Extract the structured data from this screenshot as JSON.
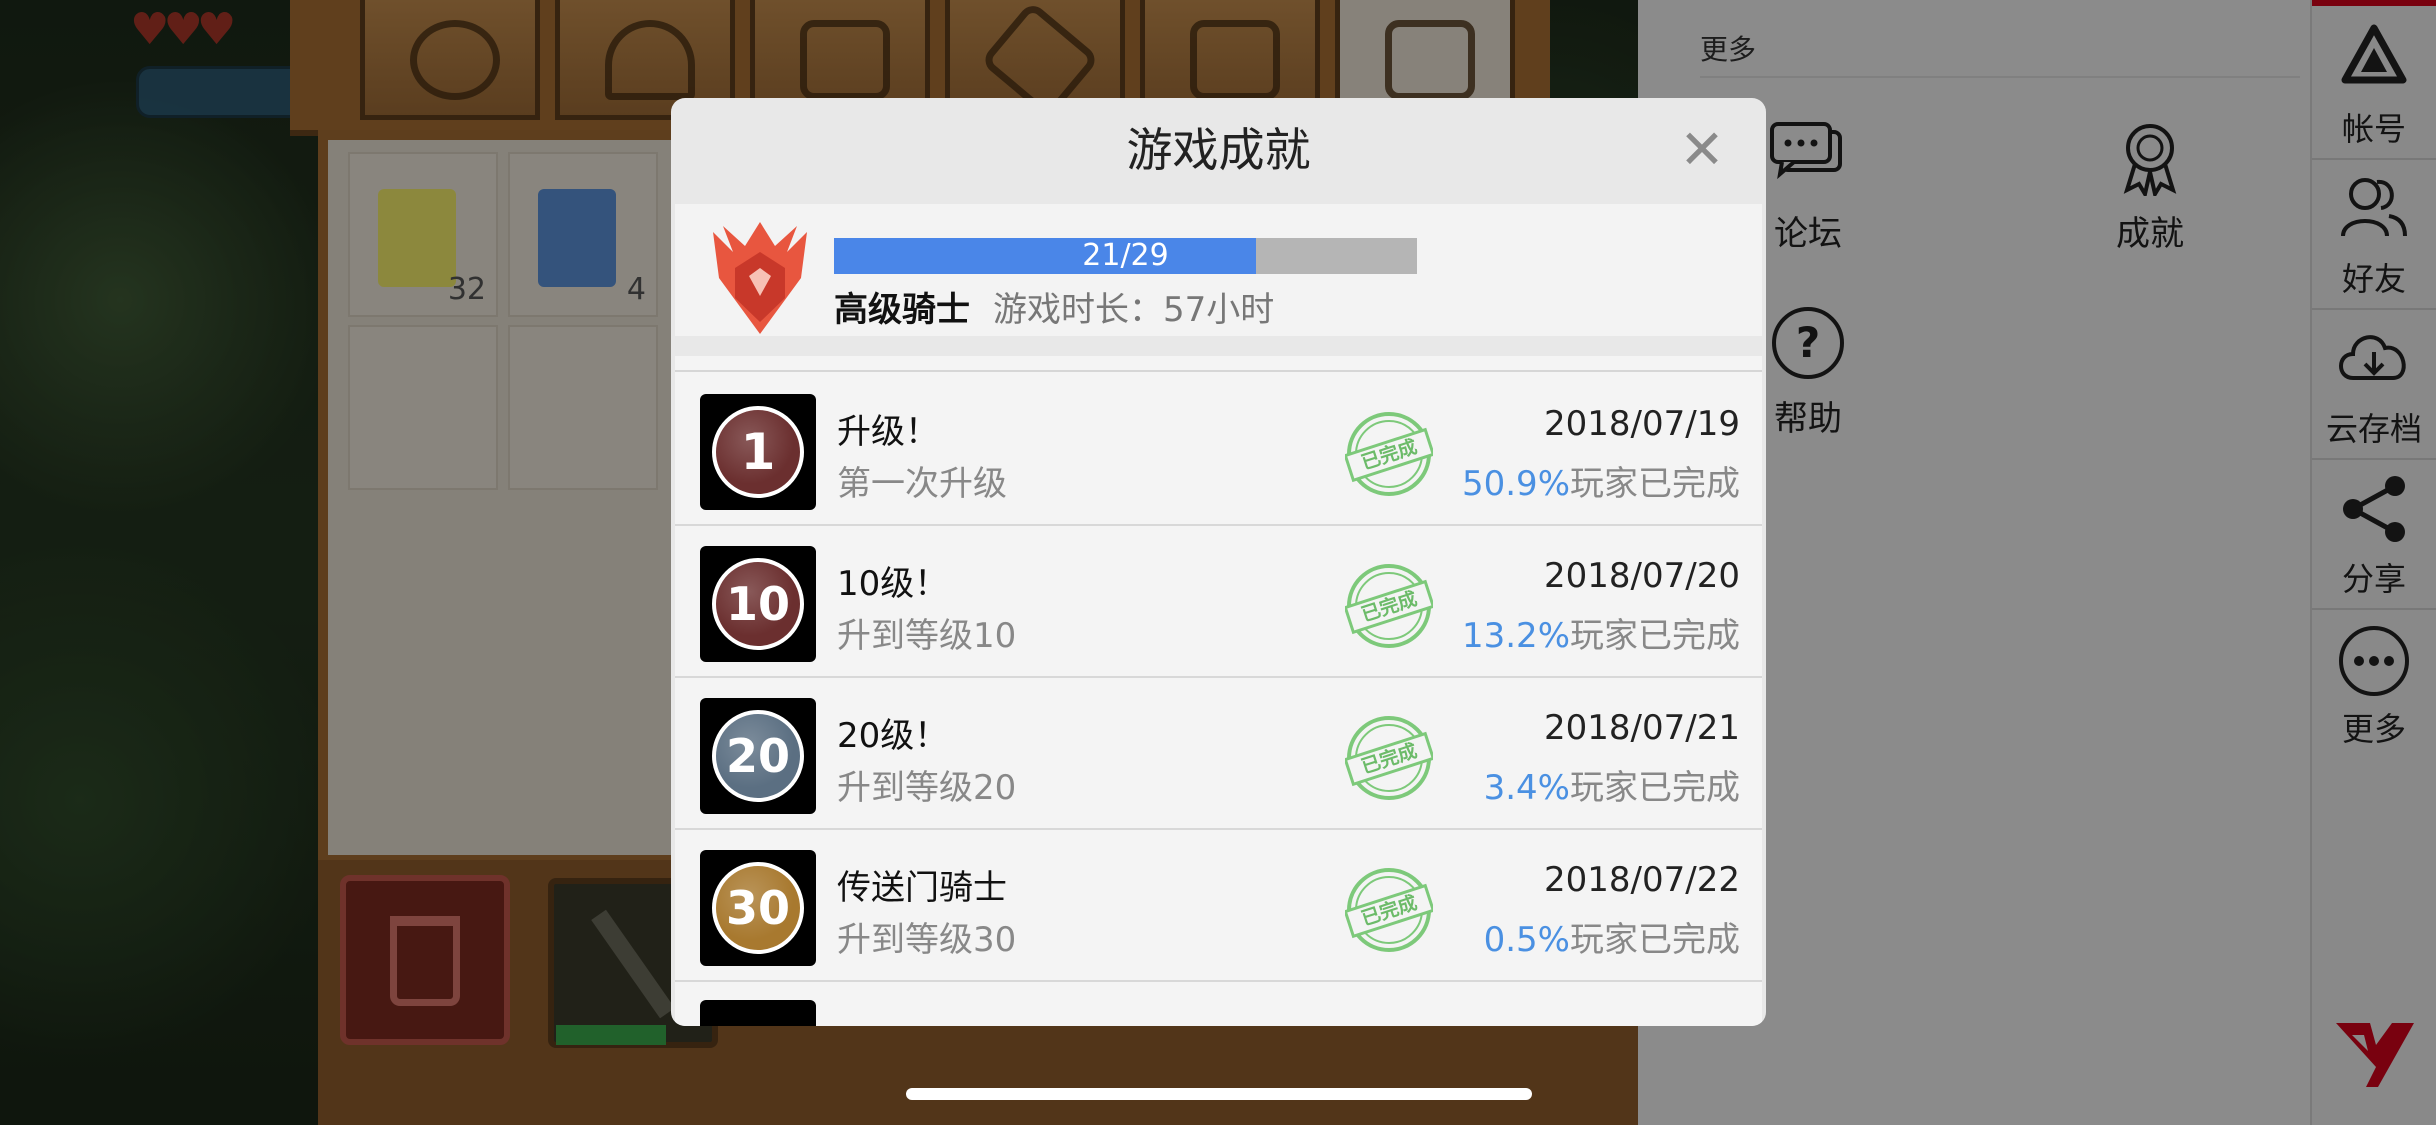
{
  "game_background": {
    "inventory_slots": [
      {
        "count": "32",
        "color": "#f2ea6a"
      },
      {
        "count": "4",
        "color": "#5a8fd6"
      }
    ]
  },
  "menu_panel": {
    "section_title": "更多",
    "items": [
      {
        "label": "论坛",
        "icon": "forum-chat-icon"
      },
      {
        "label": "成就",
        "icon": "award-ribbon-icon"
      },
      {
        "label": "帮助",
        "icon": "help-question-icon"
      }
    ]
  },
  "sidebar": {
    "items": [
      {
        "label": "帐号",
        "icon": "account-logo-icon"
      },
      {
        "label": "好友",
        "icon": "friends-icon"
      },
      {
        "label": "云存档",
        "icon": "cloud-download-icon"
      },
      {
        "label": "分享",
        "icon": "share-icon"
      },
      {
        "label": "更多",
        "icon": "more-dots-icon"
      }
    ],
    "brand_icon": "brand-logo-icon",
    "accent_color": "#d0021b"
  },
  "dialog": {
    "title": "游戏成就",
    "close_glyph": "✕",
    "summary": {
      "emblem_icon": "knight-rank-emblem-icon",
      "progress_text": "21/29",
      "progress_fraction": 0.724,
      "rank_name": "高级骑士",
      "playtime_label": "游戏时长：",
      "playtime_value": "57小时"
    },
    "stamp_text": "已完成",
    "pct_suffix": "玩家已完成",
    "achievements": [
      {
        "badge_text": "1",
        "badge_color": "#6b2f2f",
        "title": "升级！",
        "subtitle": "第一次升级",
        "date": "2018/07/19",
        "percent": "50.9%"
      },
      {
        "badge_text": "10",
        "badge_color": "#6b2f2f",
        "title": "10级！",
        "subtitle": "升到等级10",
        "date": "2018/07/20",
        "percent": "13.2%"
      },
      {
        "badge_text": "20",
        "badge_color": "#5b6f82",
        "title": "20级！",
        "subtitle": "升到等级20",
        "date": "2018/07/21",
        "percent": "3.4%"
      },
      {
        "badge_text": "30",
        "badge_color": "#a8792f",
        "title": "传送门骑士",
        "subtitle": "升到等级30",
        "date": "2018/07/22",
        "percent": "0.5%"
      }
    ]
  }
}
